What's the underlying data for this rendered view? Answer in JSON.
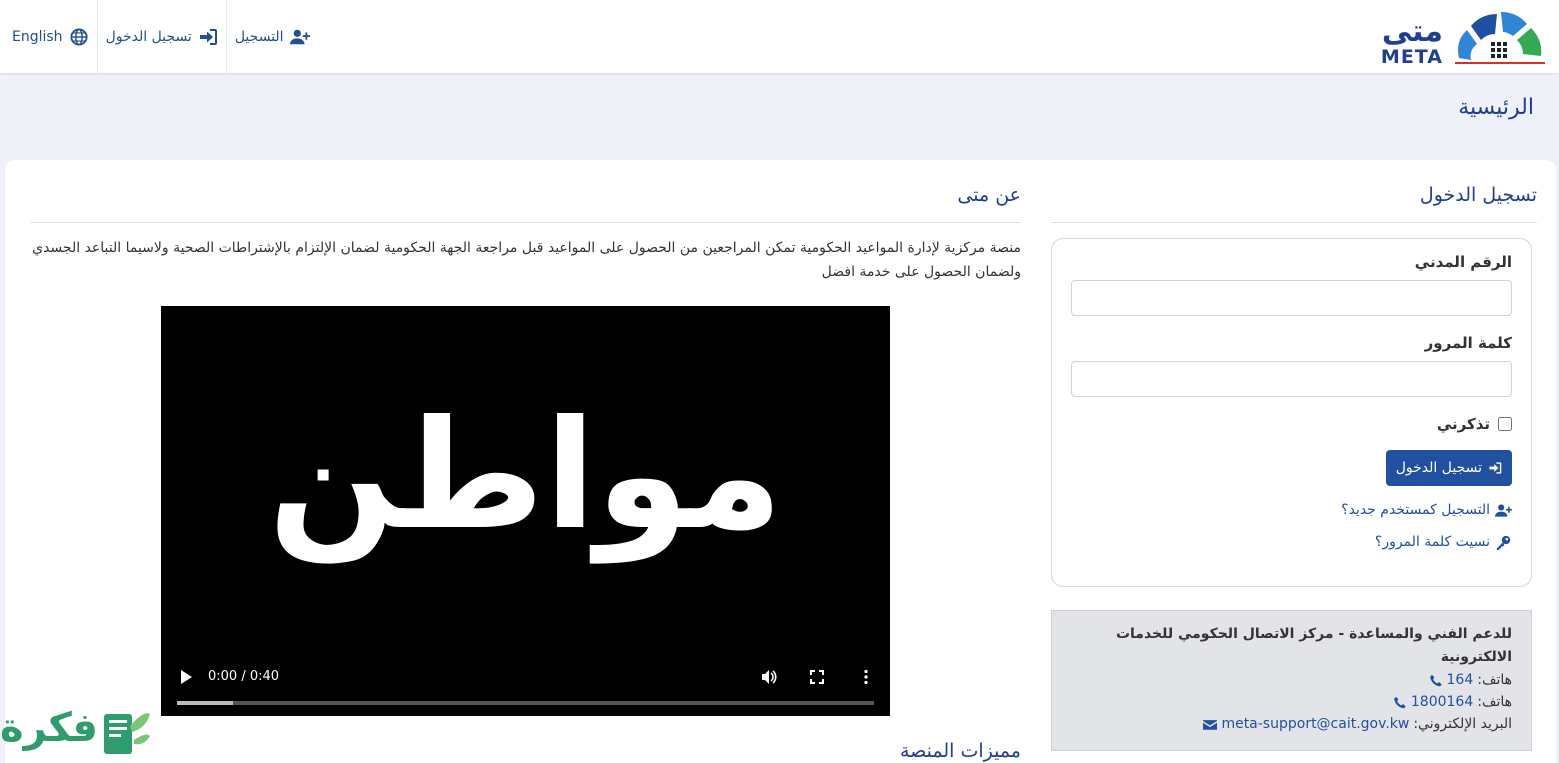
{
  "navbar": {
    "links": {
      "english": "English",
      "login": "تسجيل الدخول",
      "register": "التسجيل"
    },
    "logo": {
      "arabic": "متى",
      "english": "META"
    }
  },
  "breadcrumb": {
    "title": "الرئيسية"
  },
  "login": {
    "title": "تسجيل الدخول",
    "civil_id_label": "الرقم المدني",
    "civil_id_value": "",
    "password_label": "كلمة المرور",
    "password_value": "",
    "remember_label": "تذكرني",
    "remember_checked": false,
    "submit_label": "تسجيل الدخول",
    "register_link": "التسجيل كمستخدم جديد؟",
    "forgot_link": "نسيت كلمة المرور؟"
  },
  "support": {
    "title": "للدعم الفني والمساعدة - مركز الاتصال الحكومي للخدمات الالكترونية",
    "phone_label_1": "هاتف:",
    "phone_1": "164",
    "phone_label_2": "هاتف:",
    "phone_2": "1800164",
    "email_label": "البريد الإلكتروني:",
    "email": "meta-support@cait.gov.kw"
  },
  "about": {
    "title": "عن متى",
    "description": "منصة مركزية لإدارة المواعيد الحكومية تمكن المراجعين من الحصول على المواعيد قبل مراجعة الجهة الحكومية لضمان الإلتزام بالإشتراطات الصحية ولاسيما التباعد الجسدي ولضمان الحصول على خدمة افضل",
    "features_title": "مميزات المنصة"
  },
  "video": {
    "frame_text": "مواطن",
    "time": "0:00 / 0:40",
    "progress": 0.08
  },
  "watermark": {
    "text": "فكرة"
  },
  "colors": {
    "primary": "#2150a0",
    "title": "#1f3f8f",
    "background": "#eef2f8"
  }
}
